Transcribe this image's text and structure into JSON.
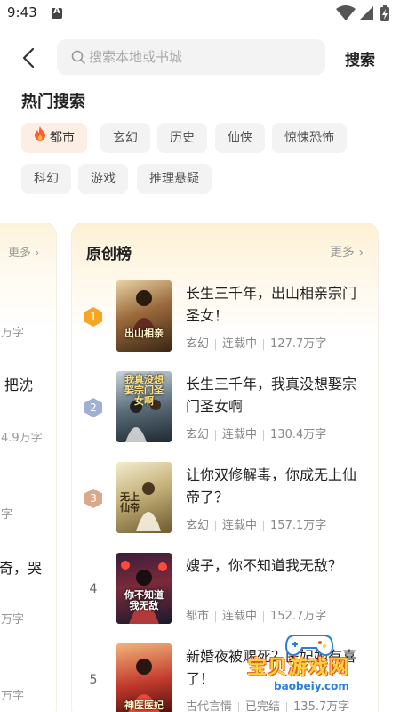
{
  "status_bar": {
    "time": "9:43"
  },
  "search": {
    "back_icon": "chevron-left-icon",
    "placeholder": "搜索本地或书城",
    "value": "",
    "button_label": "搜索"
  },
  "hot_search": {
    "title": "热门搜索",
    "tags": [
      {
        "label": "都市",
        "icon": "fire-icon",
        "active": true
      },
      {
        "label": "玄幻"
      },
      {
        "label": "历史"
      },
      {
        "label": "仙侠"
      },
      {
        "label": "惊悚恐怖"
      },
      {
        "label": "科幻"
      },
      {
        "label": "游戏"
      },
      {
        "label": "推理悬疑"
      }
    ]
  },
  "left_card": {
    "more": "更多",
    "fragments": [
      "万字",
      "把沈",
      "4.9万字",
      "字",
      "奇，哭",
      "万字",
      "万字"
    ]
  },
  "ranking": {
    "title": "原创榜",
    "more": "更多",
    "books": [
      {
        "rank": "1",
        "title": "长生三千年，出山相亲宗门圣女！",
        "genre": "玄幻",
        "status": "连载中",
        "words": "127.7万字",
        "cover_text": "出山相亲"
      },
      {
        "rank": "2",
        "title": "长生三千年，我真没想娶宗门圣女啊",
        "genre": "玄幻",
        "status": "连载中",
        "words": "130.4万字",
        "cover_text": "我真没想娶宗门圣女啊"
      },
      {
        "rank": "3",
        "title": "让你双修解毒，你成无上仙帝了？",
        "genre": "玄幻",
        "status": "连载中",
        "words": "157.1万字",
        "cover_text": "无上仙帝"
      },
      {
        "rank": "4",
        "title": "嫂子，你不知道我无敌？",
        "genre": "都市",
        "status": "连载中",
        "words": "152.7万字",
        "cover_text": "你不知道我无敌"
      },
      {
        "rank": "5",
        "title": "新婚夜被赐死？医妃她有喜了！",
        "genre": "古代言情",
        "status": "已完结",
        "words": "135.7万字",
        "cover_text": "神医医妃"
      }
    ]
  },
  "watermark": {
    "text": "宝贝游戏网",
    "url": "baobeiy.com"
  },
  "colors": {
    "accent_fire": "#ff5a2c",
    "rank1": "#f5a623",
    "rank2": "#9fb0d6",
    "rank3": "#d8a98a"
  }
}
